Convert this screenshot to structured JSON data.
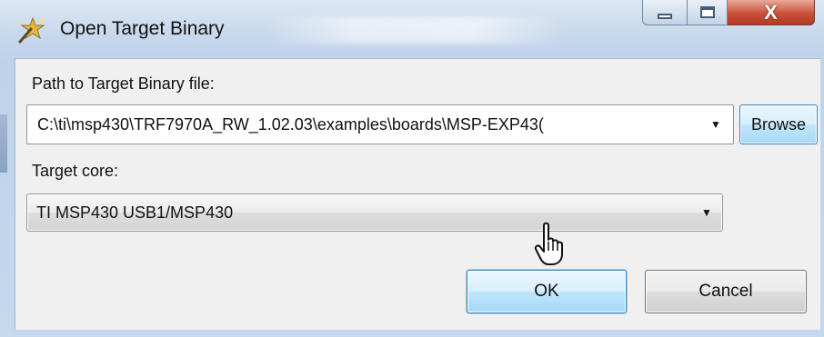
{
  "window": {
    "title": "Open Target Binary",
    "app_icon": "wizard-wand-icon",
    "minimize_icon": "minimize-icon",
    "maximize_icon": "maximize-icon",
    "close_icon": "close-icon",
    "close_glyph": "X"
  },
  "form": {
    "path_label": "Path to Target Binary file:",
    "path_value": "C:\\ti\\msp430\\TRF7970A_RW_1.02.03\\examples\\boards\\MSP-EXP43(",
    "browse_label": "Browse",
    "core_label": "Target core:",
    "core_value": "TI MSP430 USB1/MSP430",
    "dropdown_icon": "dropdown-arrow-icon",
    "dropdown_glyph": "▼"
  },
  "buttons": {
    "ok_label": "OK",
    "cancel_label": "Cancel"
  },
  "cursor": {
    "icon": "hand-pointer-cursor-icon"
  },
  "colors": {
    "accent_border": "#3c7fb1",
    "close_red": "#c9513a",
    "title_bar": "#c7d8ec",
    "dialog_bg": "#f0f0f0"
  }
}
